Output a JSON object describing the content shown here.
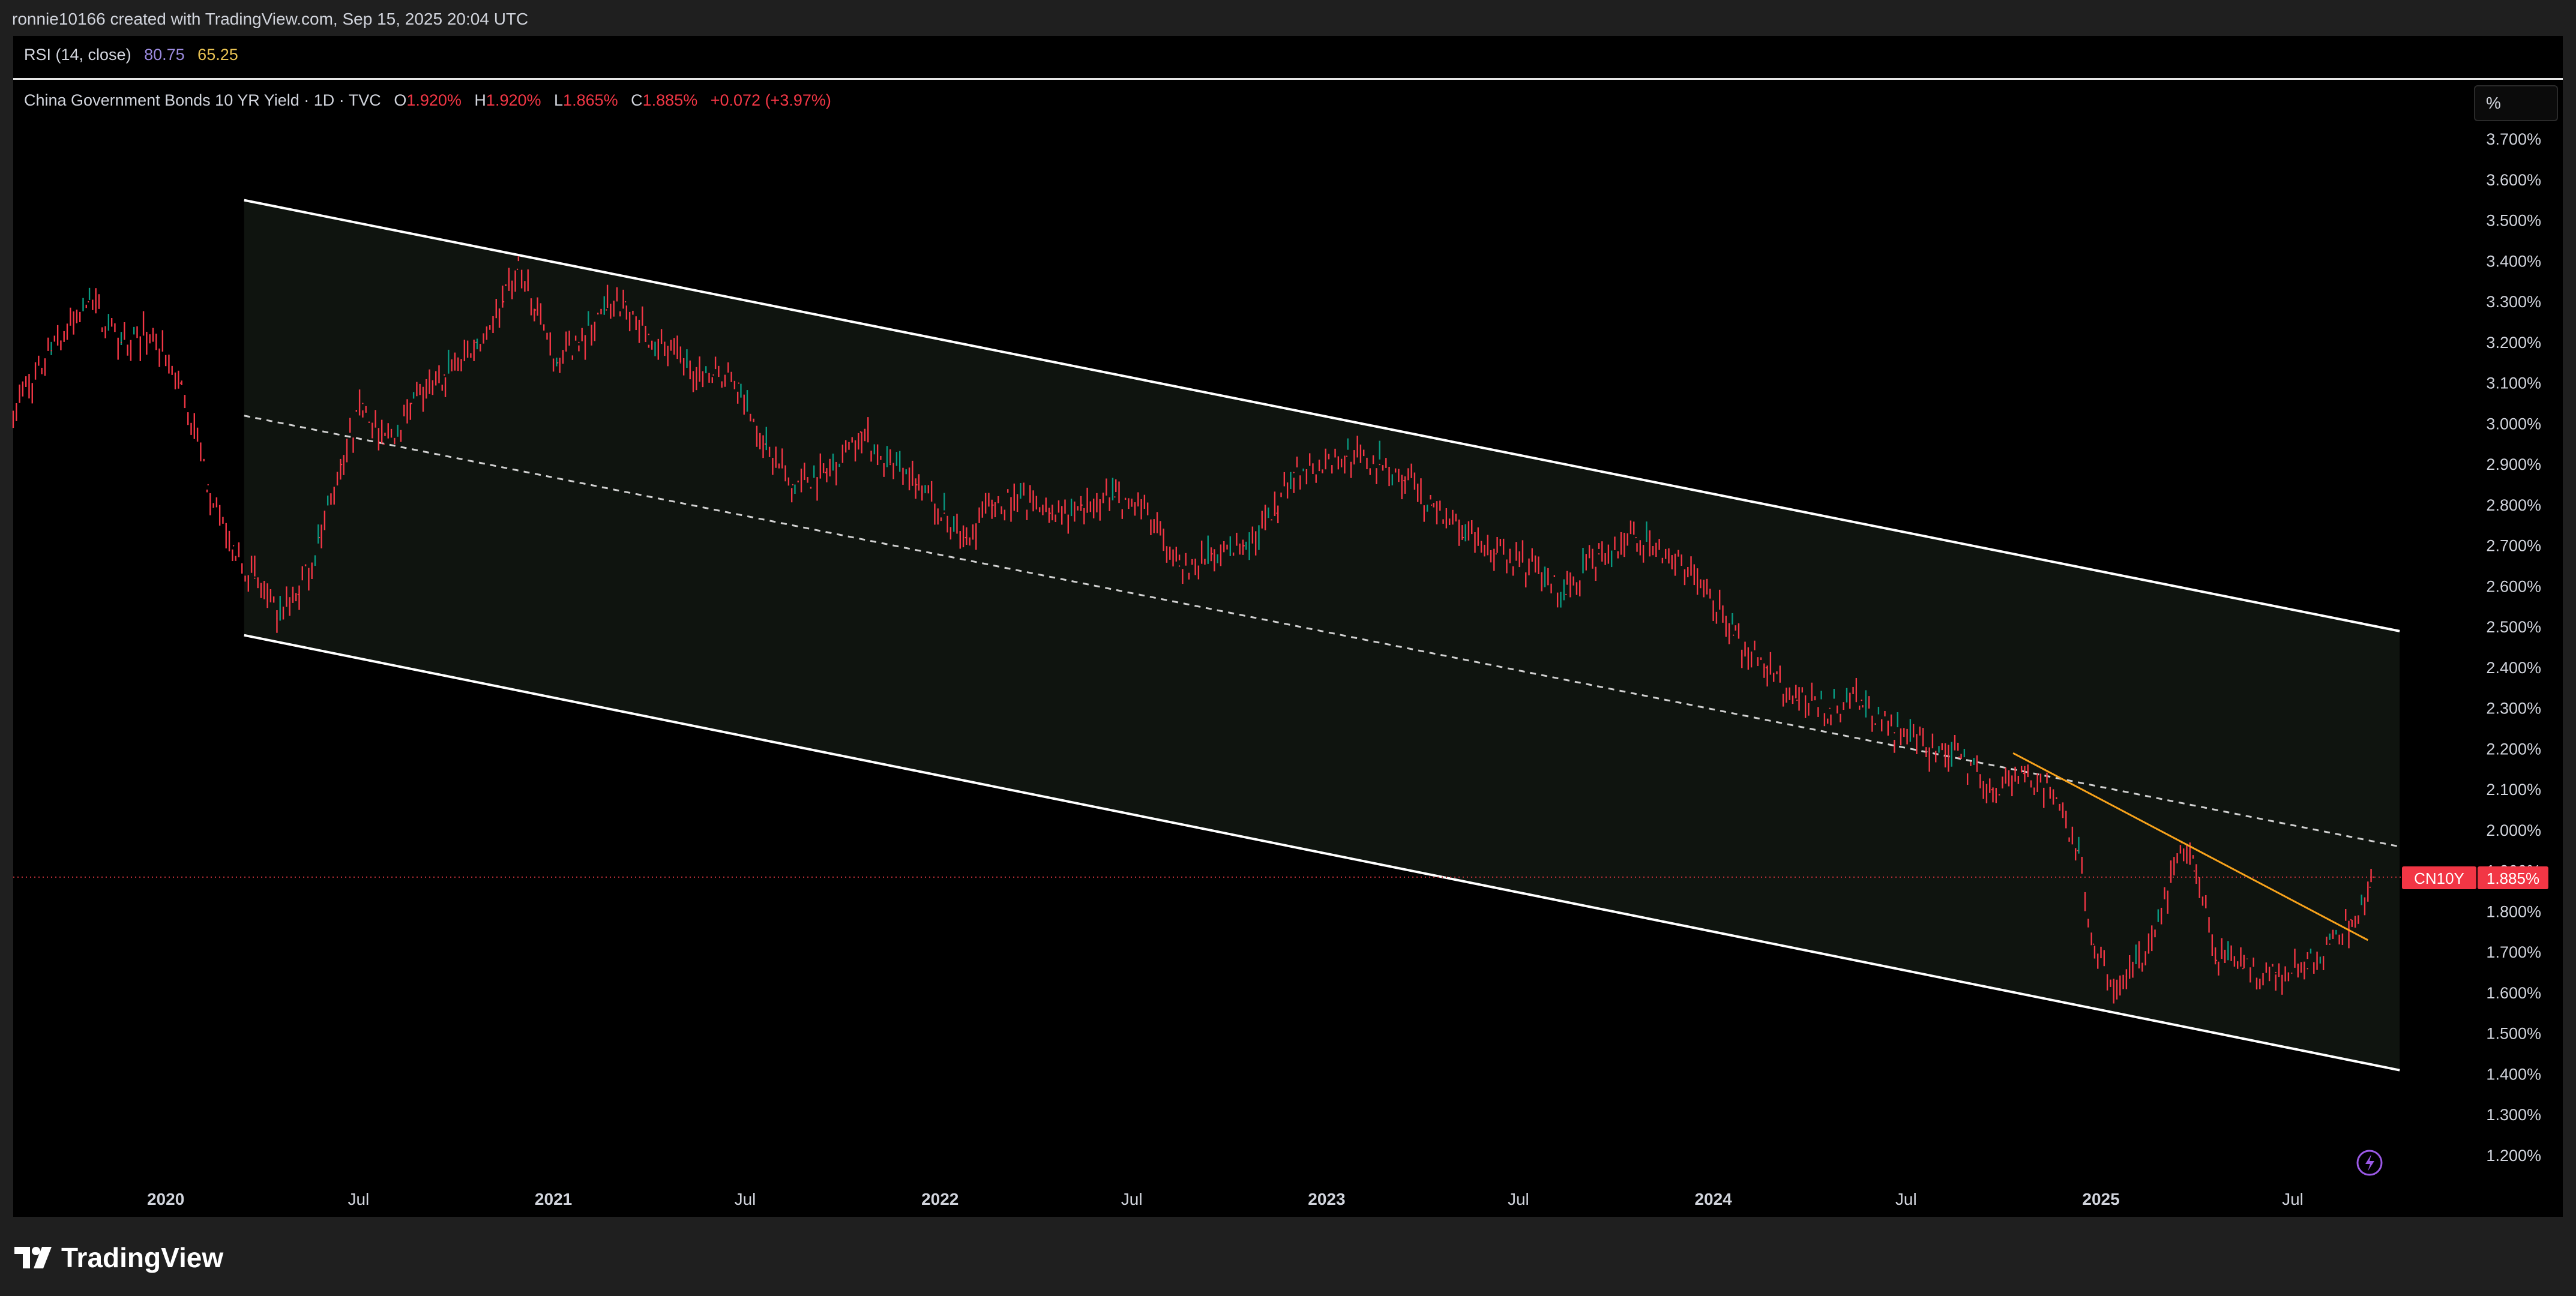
{
  "header": {
    "attribution": "ronnie10166 created with TradingView.com, Sep 15, 2025 20:04 UTC"
  },
  "rsi_pane": {
    "label": "RSI (14, close)",
    "value_1": "80.75",
    "value_2": "65.25"
  },
  "main_pane": {
    "symbol_title": "China Government Bonds 10 YR Yield · 1D · TVC",
    "open_key": "O",
    "open_value": "1.920%",
    "high_key": "H",
    "high_value": "1.920%",
    "low_key": "L",
    "low_value": "1.865%",
    "close_key": "C",
    "close_value": "1.885%",
    "change": "+0.072 (+3.97%)",
    "unit_button": "%",
    "price_tag_symbol": "CN10Y",
    "price_tag_value": "1.885%"
  },
  "footer": {
    "brand": "TradingView"
  },
  "colors": {
    "background": "#000000",
    "candle_down": "#f23645",
    "candle_up": "#089981",
    "channel_line": "#ffffff",
    "channel_fill": "#0f140f",
    "trendline": "#f7a21b",
    "rsi_line_1": "#9c8be0",
    "rsi_line_2": "#e7c152"
  },
  "icons": [
    "tradingview-logo-icon",
    "lightning-icon"
  ],
  "chart_data": {
    "type": "line",
    "title": "China Government Bonds 10 YR Yield · 1D · TVC",
    "ylabel": "%",
    "ylim": [
      1.15,
      3.75
    ],
    "y_ticks": [
      "3.700%",
      "3.600%",
      "3.500%",
      "3.400%",
      "3.300%",
      "3.200%",
      "3.100%",
      "3.000%",
      "2.900%",
      "2.800%",
      "2.700%",
      "2.600%",
      "2.500%",
      "2.400%",
      "2.300%",
      "2.200%",
      "2.100%",
      "2.000%",
      "1.900%",
      "1.800%",
      "1.700%",
      "1.600%",
      "1.500%",
      "1.400%",
      "1.300%",
      "1.200%"
    ],
    "x_ticks": [
      {
        "label": "2020",
        "date": "2020-01-01",
        "year": true
      },
      {
        "label": "Jul",
        "date": "2020-07-01",
        "year": false
      },
      {
        "label": "2021",
        "date": "2021-01-01",
        "year": true
      },
      {
        "label": "Jul",
        "date": "2021-07-01",
        "year": false
      },
      {
        "label": "2022",
        "date": "2022-01-01",
        "year": true
      },
      {
        "label": "Jul",
        "date": "2022-07-01",
        "year": false
      },
      {
        "label": "2023",
        "date": "2023-01-01",
        "year": true
      },
      {
        "label": "Jul",
        "date": "2023-07-01",
        "year": false
      },
      {
        "label": "2024",
        "date": "2024-01-01",
        "year": true
      },
      {
        "label": "Jul",
        "date": "2024-07-01",
        "year": false
      },
      {
        "label": "2025",
        "date": "2025-01-01",
        "year": true
      },
      {
        "label": "Jul",
        "date": "2025-07-01",
        "year": false
      }
    ],
    "xlim": [
      "2019-08-10",
      "2025-12-01"
    ],
    "series": [
      {
        "name": "CN10Y",
        "points": [
          [
            "2019-08-10",
            3.03
          ],
          [
            "2019-09-15",
            3.18
          ],
          [
            "2019-10-20",
            3.3
          ],
          [
            "2019-11-20",
            3.2
          ],
          [
            "2019-12-20",
            3.22
          ],
          [
            "2020-01-15",
            3.1
          ],
          [
            "2020-02-10",
            2.85
          ],
          [
            "2020-03-05",
            2.7
          ],
          [
            "2020-03-25",
            2.62
          ],
          [
            "2020-04-15",
            2.52
          ],
          [
            "2020-05-05",
            2.58
          ],
          [
            "2020-05-25",
            2.72
          ],
          [
            "2020-06-15",
            2.9
          ],
          [
            "2020-07-05",
            3.05
          ],
          [
            "2020-07-25",
            2.95
          ],
          [
            "2020-08-20",
            3.05
          ],
          [
            "2020-09-20",
            3.12
          ],
          [
            "2020-10-20",
            3.2
          ],
          [
            "2020-11-15",
            3.3
          ],
          [
            "2020-11-28",
            3.38
          ],
          [
            "2020-12-15",
            3.28
          ],
          [
            "2021-01-05",
            3.15
          ],
          [
            "2021-01-25",
            3.2
          ],
          [
            "2021-02-20",
            3.28
          ],
          [
            "2021-03-10",
            3.3
          ],
          [
            "2021-04-01",
            3.22
          ],
          [
            "2021-05-01",
            3.15
          ],
          [
            "2021-06-01",
            3.12
          ],
          [
            "2021-06-25",
            3.1
          ],
          [
            "2021-07-20",
            2.95
          ],
          [
            "2021-08-15",
            2.85
          ],
          [
            "2021-09-15",
            2.88
          ],
          [
            "2021-10-18",
            2.98
          ],
          [
            "2021-11-15",
            2.9
          ],
          [
            "2021-12-10",
            2.85
          ],
          [
            "2022-01-05",
            2.78
          ],
          [
            "2022-01-25",
            2.72
          ],
          [
            "2022-02-20",
            2.8
          ],
          [
            "2022-03-15",
            2.82
          ],
          [
            "2022-04-15",
            2.78
          ],
          [
            "2022-05-15",
            2.8
          ],
          [
            "2022-06-15",
            2.82
          ],
          [
            "2022-07-10",
            2.8
          ],
          [
            "2022-08-15",
            2.65
          ],
          [
            "2022-09-15",
            2.68
          ],
          [
            "2022-10-15",
            2.7
          ],
          [
            "2022-11-15",
            2.78
          ],
          [
            "2022-12-01",
            2.88
          ],
          [
            "2022-12-25",
            2.9
          ],
          [
            "2023-01-20",
            2.92
          ],
          [
            "2023-02-20",
            2.9
          ],
          [
            "2023-03-15",
            2.86
          ],
          [
            "2023-04-10",
            2.8
          ],
          [
            "2023-05-10",
            2.72
          ],
          [
            "2023-06-10",
            2.68
          ],
          [
            "2023-07-05",
            2.66
          ],
          [
            "2023-08-15",
            2.58
          ],
          [
            "2023-09-15",
            2.68
          ],
          [
            "2023-10-20",
            2.72
          ],
          [
            "2023-11-20",
            2.68
          ],
          [
            "2023-12-20",
            2.6
          ],
          [
            "2024-01-20",
            2.48
          ],
          [
            "2024-02-20",
            2.4
          ],
          [
            "2024-03-20",
            2.32
          ],
          [
            "2024-04-20",
            2.3
          ],
          [
            "2024-05-20",
            2.32
          ],
          [
            "2024-06-20",
            2.24
          ],
          [
            "2024-07-20",
            2.2
          ],
          [
            "2024-08-20",
            2.18
          ],
          [
            "2024-09-20",
            2.1
          ],
          [
            "2024-10-20",
            2.14
          ],
          [
            "2024-11-20",
            2.08
          ],
          [
            "2024-12-10",
            1.95
          ],
          [
            "2024-12-25",
            1.72
          ],
          [
            "2025-01-10",
            1.62
          ],
          [
            "2025-01-25",
            1.64
          ],
          [
            "2025-02-15",
            1.7
          ],
          [
            "2025-03-05",
            1.85
          ],
          [
            "2025-03-18",
            1.97
          ],
          [
            "2025-03-30",
            1.9
          ],
          [
            "2025-04-20",
            1.68
          ],
          [
            "2025-05-15",
            1.66
          ],
          [
            "2025-06-15",
            1.65
          ],
          [
            "2025-07-15",
            1.66
          ],
          [
            "2025-08-05",
            1.72
          ],
          [
            "2025-08-25",
            1.78
          ],
          [
            "2025-09-12",
            1.86
          ],
          [
            "2025-09-15",
            1.885
          ]
        ]
      }
    ],
    "channel": {
      "upper": [
        [
          "2020-03-15",
          3.55
        ],
        [
          "2025-10-10",
          2.49
        ]
      ],
      "middle": [
        [
          "2020-03-15",
          3.02
        ],
        [
          "2025-10-10",
          1.96
        ]
      ],
      "lower": [
        [
          "2020-03-15",
          2.48
        ],
        [
          "2025-10-10",
          1.41
        ]
      ]
    },
    "trendline": [
      [
        "2024-10-10",
        2.19
      ],
      [
        "2025-09-10",
        1.73
      ]
    ],
    "last_price_line": 1.885,
    "grid": false,
    "legend": "top-left"
  }
}
